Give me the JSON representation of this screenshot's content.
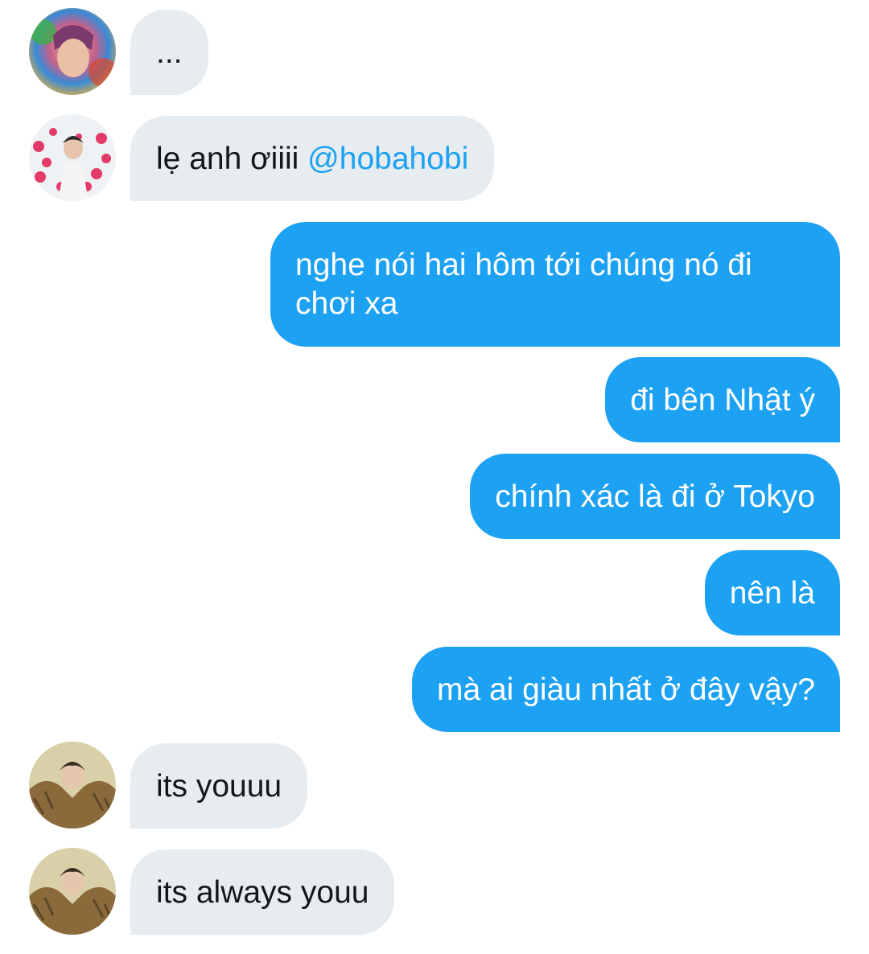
{
  "conversation": {
    "messages": [
      {
        "direction": "incoming",
        "text": "..."
      },
      {
        "direction": "incoming",
        "text": "lẹ anh ơiiii ",
        "mention": "@hobahobi"
      },
      {
        "direction": "outgoing",
        "text": "nghe nói hai hôm tới chúng nó đi chơi xa"
      },
      {
        "direction": "outgoing",
        "text": "đi bên Nhật ý"
      },
      {
        "direction": "outgoing",
        "text": "chính xác là đi ở Tokyo"
      },
      {
        "direction": "outgoing",
        "text": "nên là"
      },
      {
        "direction": "outgoing",
        "text": "mà ai giàu nhất ở đây vậy?"
      },
      {
        "direction": "incoming",
        "text": "its youuu"
      },
      {
        "direction": "incoming",
        "text": "its always youu"
      }
    ]
  },
  "colors": {
    "incoming_bubble": "#e6ecf0",
    "outgoing_bubble": "#1da1f2",
    "mention": "#1da1f2",
    "incoming_text": "#14171a",
    "outgoing_text": "#ffffff"
  }
}
